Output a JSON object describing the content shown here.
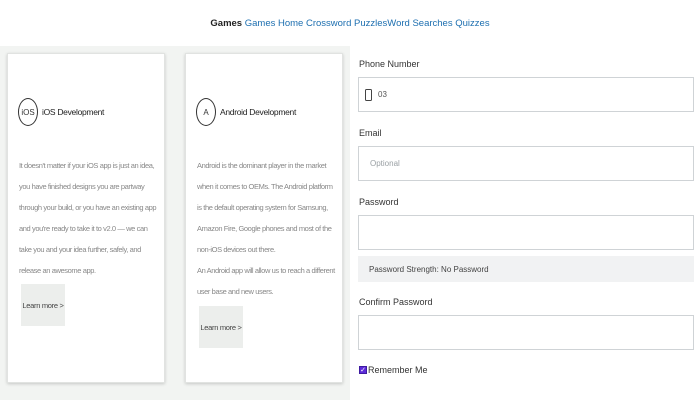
{
  "nav": {
    "brand": "Games",
    "links": [
      "Games",
      "Home",
      "Crossword Puzzles",
      "Word Searches",
      "Quizzes"
    ]
  },
  "cards": [
    {
      "icon": "iOS",
      "title": "iOS Development",
      "description": [
        "It doesn't matter if your iOS app is just an idea, you have finished designs you are partway through your build, or you have an existing app and you're ready to take it to v2.0 — we can take you and your idea further, safely, and release an awesome app."
      ],
      "button": "Learn more >"
    },
    {
      "icon": "A",
      "title": "Android Development",
      "description": [
        "Android is the dominant player in the market when it comes to OEMs. The Android platform is the default operating system for Samsung, Amazon Fire, Google phones and most of the non-iOS devices out there.",
        "An Android app will allow us to reach a different user base and new users."
      ],
      "button": "Learn more >"
    }
  ],
  "form": {
    "phone_label": "Phone Number",
    "phone_value": "03",
    "email_label": "Email",
    "email_placeholder": "Optional",
    "password_label": "Password",
    "password_strength": "Password Strength: No Password",
    "confirm_label": "Confirm Password",
    "remember_label": "Remember Me",
    "remember_checked": true
  },
  "colors": {
    "link": "#1d6fb0",
    "checkbox": "#5d2bd9",
    "panel_bg": "#f2f4f2",
    "button_bg": "#eceeec"
  },
  "icons": [
    "ios-icon",
    "android-icon",
    "phone-icon",
    "checkbox-icon"
  ]
}
